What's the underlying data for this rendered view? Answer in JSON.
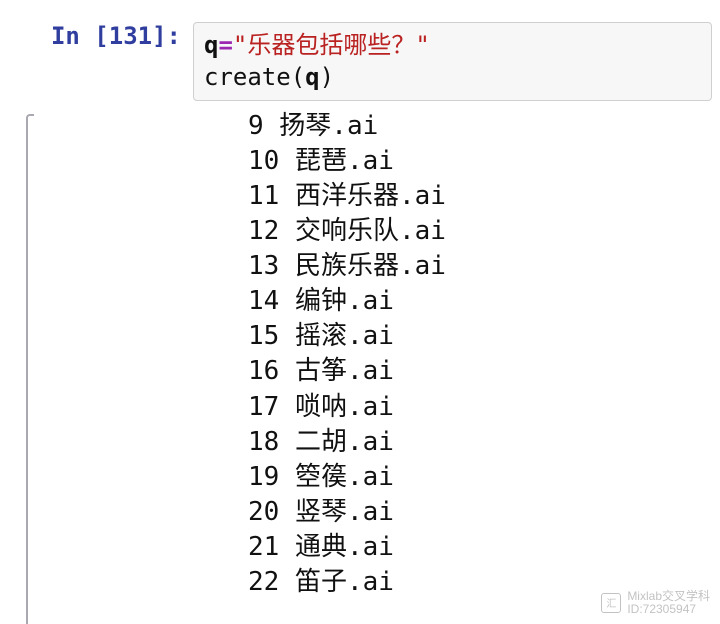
{
  "prompt": {
    "label": "In [131]:"
  },
  "code": {
    "line1": {
      "var": "q",
      "op": "=",
      "string": "\"乐器包括哪些？\""
    },
    "line2": {
      "func": "create",
      "open": "(",
      "arg": "q",
      "close": ")"
    }
  },
  "output": {
    "lines": [
      "9 扬琴.ai",
      "10 琵琶.ai",
      "11 西洋乐器.ai",
      "12 交响乐队.ai",
      "13 民族乐器.ai",
      "14 编钟.ai",
      "15 摇滚.ai",
      "16 古筝.ai",
      "17 唢呐.ai",
      "18 二胡.ai",
      "19 箜篌.ai",
      "20 竖琴.ai",
      "21 通典.ai",
      "22 笛子.ai"
    ]
  },
  "watermark": {
    "line1": "Mixlab交叉学科",
    "line2": "ID:72305947"
  }
}
